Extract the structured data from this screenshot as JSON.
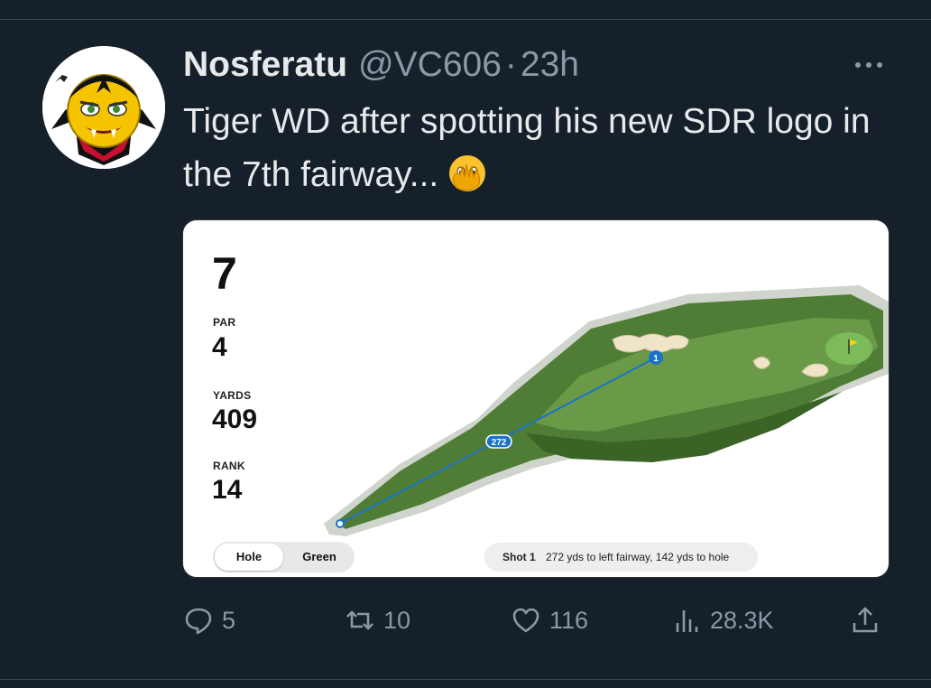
{
  "tweet": {
    "display_name": "Nosferatu",
    "handle": "@VC606",
    "separator": "·",
    "time": "23h",
    "text": "Tiger WD after spotting his new SDR logo in the 7th fairway...",
    "emoji": "face-with-open-eyes-and-hand-over-mouth"
  },
  "card": {
    "hole": "7",
    "par_label": "PAR",
    "par": "4",
    "yards_label": "YARDS",
    "yards": "409",
    "rank_label": "RANK",
    "rank": "14",
    "toggle_hole": "Hole",
    "toggle_green": "Green",
    "shot_title": "Shot 1",
    "shot_desc": "272 yds to left fairway, 142 yds to hole",
    "shot_distance_tag": "272",
    "shot_number_marker": "1"
  },
  "actions": {
    "replies": "5",
    "retweets": "10",
    "likes": "116",
    "views": "28.3K"
  },
  "colors": {
    "background": "#15202b",
    "secondary_text": "#8b98a5",
    "shot_line": "#1a73c9",
    "fairway": "#4f7d35"
  }
}
